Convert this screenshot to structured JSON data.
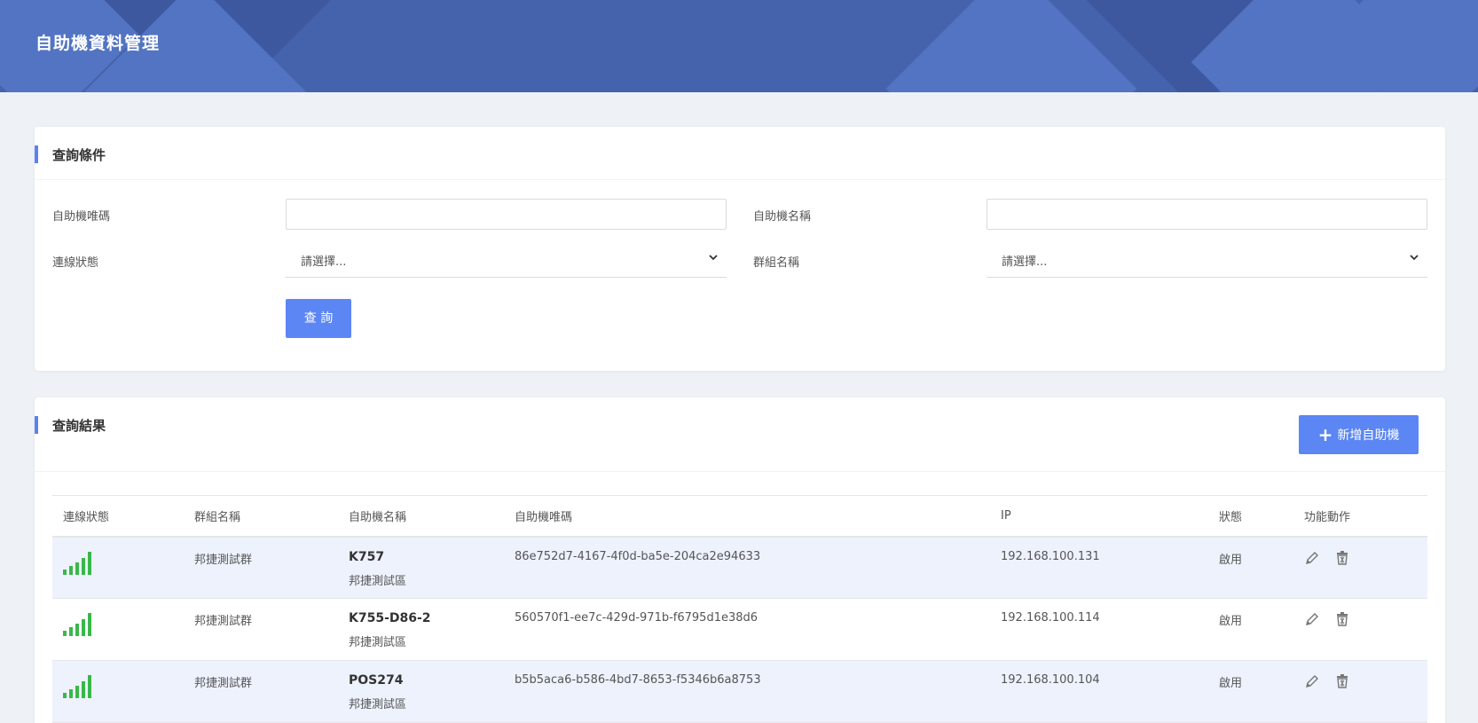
{
  "header": {
    "title": "自助機資料管理"
  },
  "query": {
    "title": "查詢條件",
    "fields": {
      "kiosk_code_label": "自助機唯碼",
      "kiosk_code_value": "",
      "kiosk_name_label": "自助機名稱",
      "kiosk_name_value": "",
      "conn_status_label": "連線狀態",
      "conn_status_value": "請選擇...",
      "group_name_label": "群組名稱",
      "group_name_value": "請選擇..."
    },
    "search_button": "查 詢"
  },
  "results": {
    "title": "查詢結果",
    "add_button": "新增自助機",
    "columns": [
      "連線狀態",
      "群組名稱",
      "自助機名稱",
      "自助機唯碼",
      "IP",
      "狀態",
      "功能動作"
    ],
    "rows": [
      {
        "group": "邦捷測試群",
        "name": "K757",
        "area": "邦捷測試區",
        "code": "86e752d7-4167-4f0d-ba5e-204ca2e94633",
        "ip": "192.168.100.131",
        "status": "啟用",
        "signal": "strong"
      },
      {
        "group": "邦捷測試群",
        "name": "K755-D86-2",
        "area": "邦捷測試區",
        "code": "560570f1-ee7c-429d-971b-f6795d1e38d6",
        "ip": "192.168.100.114",
        "status": "啟用",
        "signal": "strong"
      },
      {
        "group": "邦捷測試群",
        "name": "POS274",
        "area": "邦捷測試區",
        "code": "b5b5aca6-b586-4bd7-8653-f5346b6a8753",
        "ip": "192.168.100.104",
        "status": "啟用",
        "signal": "strong"
      }
    ]
  },
  "colors": {
    "accent": "#5b86f3",
    "banner": "#4563ad",
    "signal": "#39b84a",
    "row_shade": "#edf2fd"
  },
  "icons": {
    "edit": "pencil-icon",
    "delete": "trash-icon",
    "signal": "signal-icon",
    "add": "plus-icon"
  }
}
